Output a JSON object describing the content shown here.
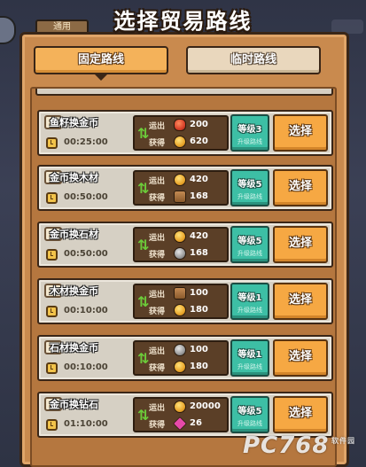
{
  "title": "选择贸易路线",
  "background": {
    "tab_label": "通用"
  },
  "tabs": [
    {
      "label": "固定路线",
      "active": true
    },
    {
      "label": "临时路线",
      "active": false
    }
  ],
  "labels": {
    "out": "运出",
    "get": "获得"
  },
  "routes": [
    {
      "name": "鱼籽换金币",
      "time": "00:25:00",
      "out_icon": "seed-icon",
      "out_amount": "200",
      "get_icon": "coin-icon",
      "get_amount": "620",
      "level": "等级3",
      "level_sub": "升级路线",
      "button": "选择"
    },
    {
      "name": "金币换木材",
      "time": "00:50:00",
      "out_icon": "coin-icon",
      "out_amount": "420",
      "get_icon": "wood-icon",
      "get_amount": "168",
      "level": "等级5",
      "level_sub": "升级路线",
      "button": "选择"
    },
    {
      "name": "金币换石材",
      "time": "00:50:00",
      "out_icon": "coin-icon",
      "out_amount": "420",
      "get_icon": "stone-icon",
      "get_amount": "168",
      "level": "等级5",
      "level_sub": "升级路线",
      "button": "选择"
    },
    {
      "name": "木材换金币",
      "time": "00:10:00",
      "out_icon": "wood-icon",
      "out_amount": "100",
      "get_icon": "coin-icon",
      "get_amount": "180",
      "level": "等级1",
      "level_sub": "升级路线",
      "button": "选择"
    },
    {
      "name": "石材换金币",
      "time": "00:10:00",
      "out_icon": "stone-icon",
      "out_amount": "100",
      "get_icon": "coin-icon",
      "get_amount": "180",
      "level": "等级1",
      "level_sub": "升级路线",
      "button": "选择"
    },
    {
      "name": "金币换钻石",
      "time": "01:10:00",
      "out_icon": "coin-icon",
      "out_amount": "20000",
      "get_icon": "diamond-icon",
      "get_amount": "26",
      "level": "等级5",
      "level_sub": "升级路线",
      "button": "选择"
    }
  ],
  "watermark": {
    "main": "PC768",
    "sub": "软件园"
  }
}
